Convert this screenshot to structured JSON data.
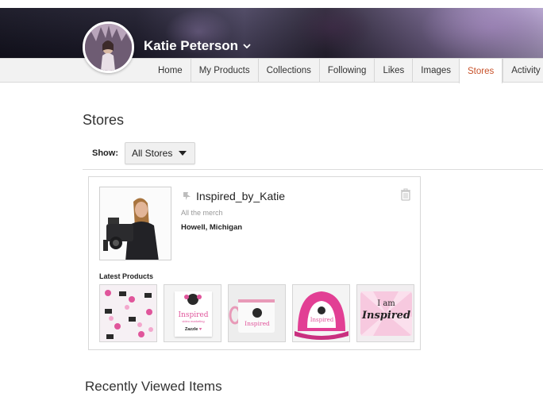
{
  "profile": {
    "username": "Katie Peterson"
  },
  "tabs": [
    {
      "label": "Home"
    },
    {
      "label": "My Products"
    },
    {
      "label": "Collections"
    },
    {
      "label": "Following"
    },
    {
      "label": "Likes"
    },
    {
      "label": "Images"
    },
    {
      "label": "Stores",
      "active": true
    },
    {
      "label": "Activity"
    }
  ],
  "page": {
    "title": "Stores",
    "show_label": "Show:",
    "show_selected": "All Stores"
  },
  "store": {
    "name": "Inspired_by_Katie",
    "tagline": "All the merch",
    "location": "Howell, Michigan",
    "latest_label": "Latest Products",
    "thumb2_line1": "Inspired",
    "thumb2_line2": "video marketing",
    "thumb2_brand": "Zazzle",
    "thumb3_text": "Inspired",
    "thumb4_text": "Inspired",
    "thumb5_line1": "I am",
    "thumb5_line2": "Inspired"
  },
  "recent": {
    "title": "Recently Viewed Items"
  },
  "colors": {
    "accent": "#c8522a",
    "pink": "#e0559b"
  }
}
